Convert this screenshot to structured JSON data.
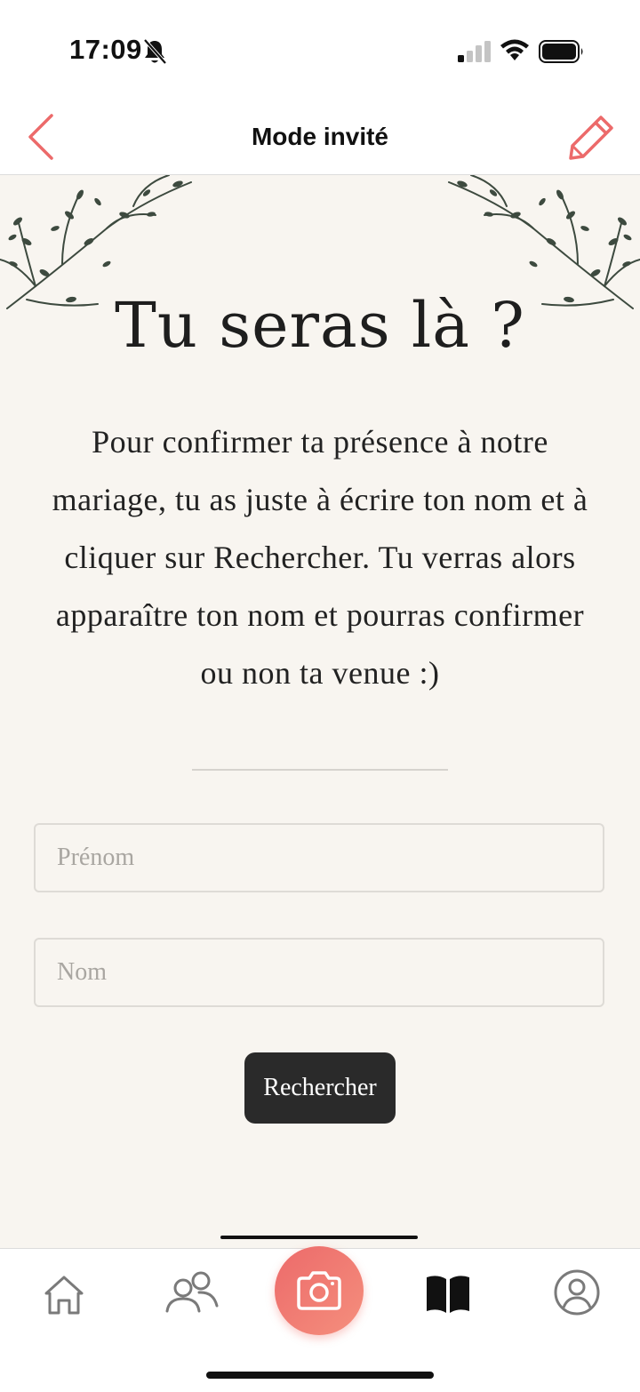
{
  "status_bar": {
    "time": "17:09",
    "icons": [
      "bell-off-icon",
      "signal-icon",
      "wifi-icon",
      "battery-icon"
    ]
  },
  "header": {
    "title": "Mode invité",
    "back_icon": "chevron-left-icon",
    "edit_icon": "pencil-icon"
  },
  "content": {
    "title": "Tu seras là ?",
    "description": "Pour confirmer ta présence à notre mariage, tu as juste à écrire ton nom et à cliquer sur Rechercher. Tu verras alors apparaître ton nom et pourras confirmer ou non ta venue :)",
    "firstname_placeholder": "Prénom",
    "lastname_placeholder": "Nom",
    "firstname_value": "",
    "lastname_value": "",
    "search_label": "Rechercher"
  },
  "tab_bar": {
    "tabs": [
      {
        "icon": "home-icon",
        "active": false
      },
      {
        "icon": "guests-icon",
        "active": false
      },
      {
        "icon": "camera-icon",
        "active": false
      },
      {
        "icon": "book-icon",
        "active": true
      },
      {
        "icon": "profile-icon",
        "active": false
      }
    ]
  },
  "colors": {
    "accent": "#ec6a6a",
    "background": "#f8f5f0",
    "button_dark": "#2a2a2a",
    "foliage": "#3d4a3f"
  }
}
